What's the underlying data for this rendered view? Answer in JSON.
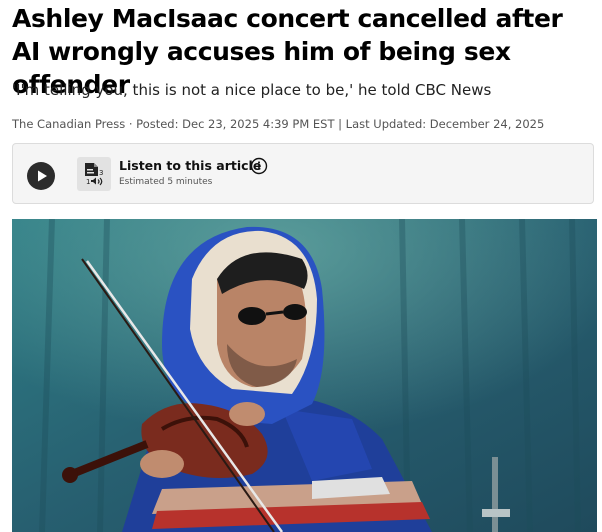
{
  "article": {
    "headline": "Ashley MacIsaac concert cancelled after AI wrongly accuses him of being sex offender",
    "dek": "'I'm telling you, this is not a nice place to be,' he told CBC News",
    "byline": "The Canadian Press · Posted: Dec 23, 2025 4:39 PM EST | Last Updated: December 24, 2025"
  },
  "audio_player": {
    "title": "Listen to this article",
    "subtitle": "Estimated 5 minutes",
    "play_icon": "play-icon",
    "doc_icon": "document-audio-icon",
    "info_icon": "info-icon"
  },
  "photo": {
    "description_icon": "photo-of-fiddler"
  },
  "colors": {
    "text": "#000000",
    "muted": "#545454",
    "player_bg": "#f5f5f5",
    "play_button": "#2c2c2c"
  }
}
